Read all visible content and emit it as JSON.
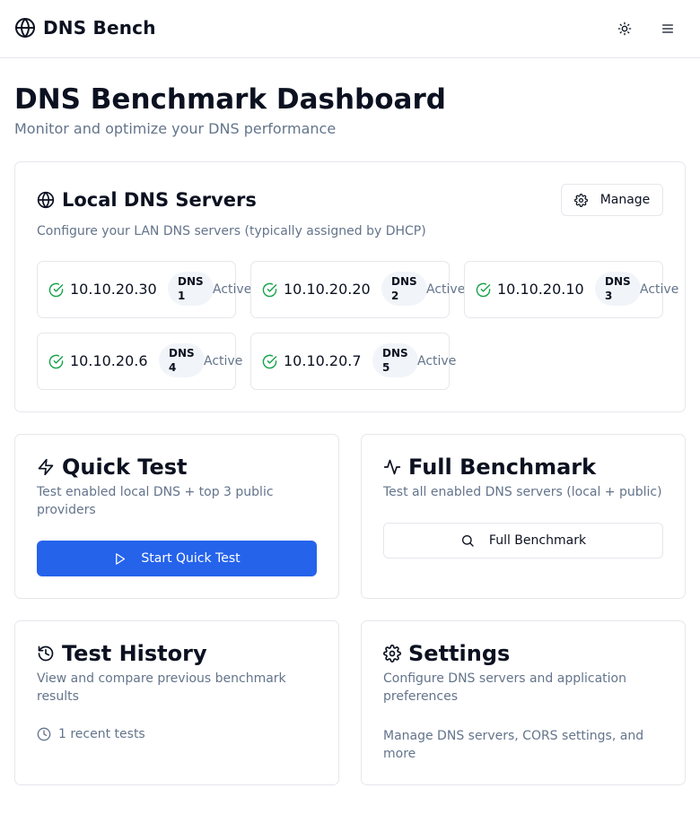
{
  "app": {
    "name": "DNS Bench"
  },
  "header": {
    "theme_icon": "sun-icon",
    "menu_icon": "menu-icon"
  },
  "page": {
    "title": "DNS Benchmark Dashboard",
    "subtitle": "Monitor and optimize your DNS performance"
  },
  "local_dns": {
    "title": "Local DNS Servers",
    "description": "Configure your LAN DNS servers (typically assigned by DHCP)",
    "manage_label": "Manage",
    "servers": [
      {
        "ip": "10.10.20.30",
        "badge_line1": "DNS",
        "badge_line2": "1",
        "status": "Active"
      },
      {
        "ip": "10.10.20.20",
        "badge_line1": "DNS",
        "badge_line2": "2",
        "status": "Active"
      },
      {
        "ip": "10.10.20.10",
        "badge_line1": "DNS",
        "badge_line2": "3",
        "status": "Active"
      },
      {
        "ip": "10.10.20.6",
        "badge_line1": "DNS",
        "badge_line2": "4",
        "status": "Active"
      },
      {
        "ip": "10.10.20.7",
        "badge_line1": "DNS",
        "badge_line2": "5",
        "status": "Active"
      }
    ]
  },
  "quick_test": {
    "title": "Quick Test",
    "description": "Test enabled local DNS + top 3 public providers",
    "button_label": "Start Quick Test"
  },
  "full_benchmark": {
    "title": "Full Benchmark",
    "description": "Test all enabled DNS servers (local + public)",
    "button_label": "Full Benchmark"
  },
  "test_history": {
    "title": "Test History",
    "description": "View and compare previous benchmark results",
    "meta": "1 recent tests"
  },
  "settings": {
    "title": "Settings",
    "description": "Configure DNS servers and application preferences",
    "meta": "Manage DNS servers, CORS settings, and more"
  },
  "colors": {
    "primary": "#2563eb",
    "success": "#16a34a",
    "muted_text": "#64748b",
    "border": "#e5e7eb",
    "badge_bg": "#f1f5f9"
  }
}
